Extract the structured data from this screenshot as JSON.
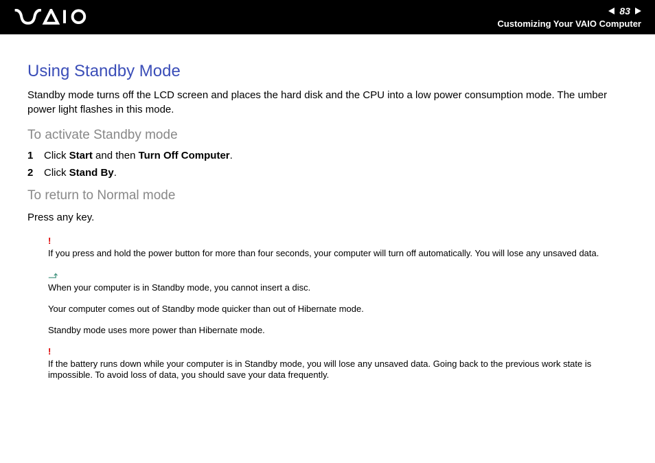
{
  "header": {
    "page_number": "83",
    "section": "Customizing Your VAIO Computer"
  },
  "title": "Using Standby Mode",
  "intro": "Standby mode turns off the LCD screen and places the hard disk and the CPU into a low power consumption mode. The umber power light flashes in this mode.",
  "activate": {
    "heading": "To activate Standby mode",
    "steps": [
      {
        "num": "1",
        "pre": "Click ",
        "b1": "Start",
        "mid": " and then ",
        "b2": "Turn Off Computer",
        "post": "."
      },
      {
        "num": "2",
        "pre": "Click ",
        "b1": "Stand By",
        "mid": "",
        "b2": "",
        "post": "."
      }
    ]
  },
  "return": {
    "heading": "To return to Normal mode",
    "text": "Press any key."
  },
  "notes": [
    {
      "type": "warn",
      "text": "If you press and hold the power button for more than four seconds, your computer will turn off automatically. You will lose any unsaved data."
    },
    {
      "type": "info",
      "text": "When your computer is in Standby mode, you cannot insert a disc."
    },
    {
      "type": "plain",
      "text": "Your computer comes out of Standby mode quicker than out of Hibernate mode."
    },
    {
      "type": "plain",
      "text": "Standby mode uses more power than Hibernate mode."
    },
    {
      "type": "warn",
      "text": "If the battery runs down while your computer is in Standby mode, you will lose any unsaved data. Going back to the previous work state is impossible. To avoid loss of data, you should save your data frequently."
    }
  ]
}
